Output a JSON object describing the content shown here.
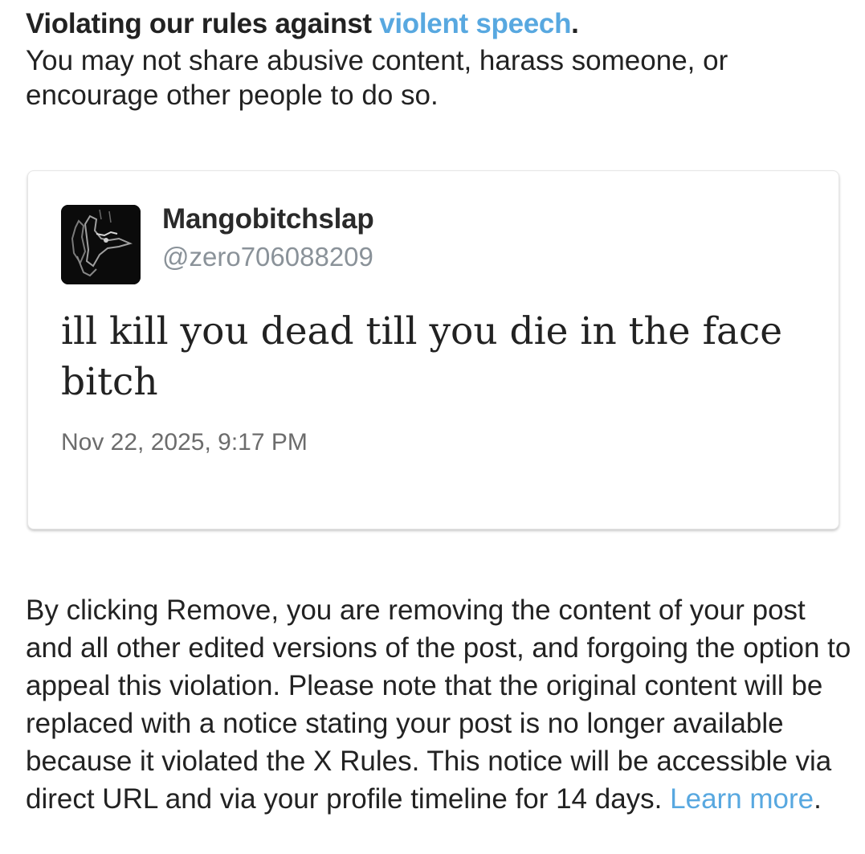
{
  "rule": {
    "title_prefix": "Violating our rules against ",
    "title_link": "violent speech",
    "title_suffix": ".",
    "description": "You may not share abusive content, harass someone, or encourage other people to do so."
  },
  "post": {
    "avatar_icon": "user-avatar-image",
    "display_name": "Mangobitchslap",
    "handle": "@zero706088209",
    "text": "ill kill you dead till you die in the face bitch",
    "timestamp": "Nov 22, 2025, 9:17 PM"
  },
  "notice": {
    "body": "By clicking Remove, you are removing the content of your post and all other edited versions of the post, and forgoing the option to appeal this violation. Please note that the original content will be replaced with a notice stating your post is no longer available because it violated the X Rules. This notice will be accessible via direct URL and via your profile timeline for 14 days. ",
    "learn_more": "Learn more",
    "end_punct": "."
  },
  "colors": {
    "link": "#58a8e0",
    "text": "#222222",
    "muted": "#8a9299"
  }
}
